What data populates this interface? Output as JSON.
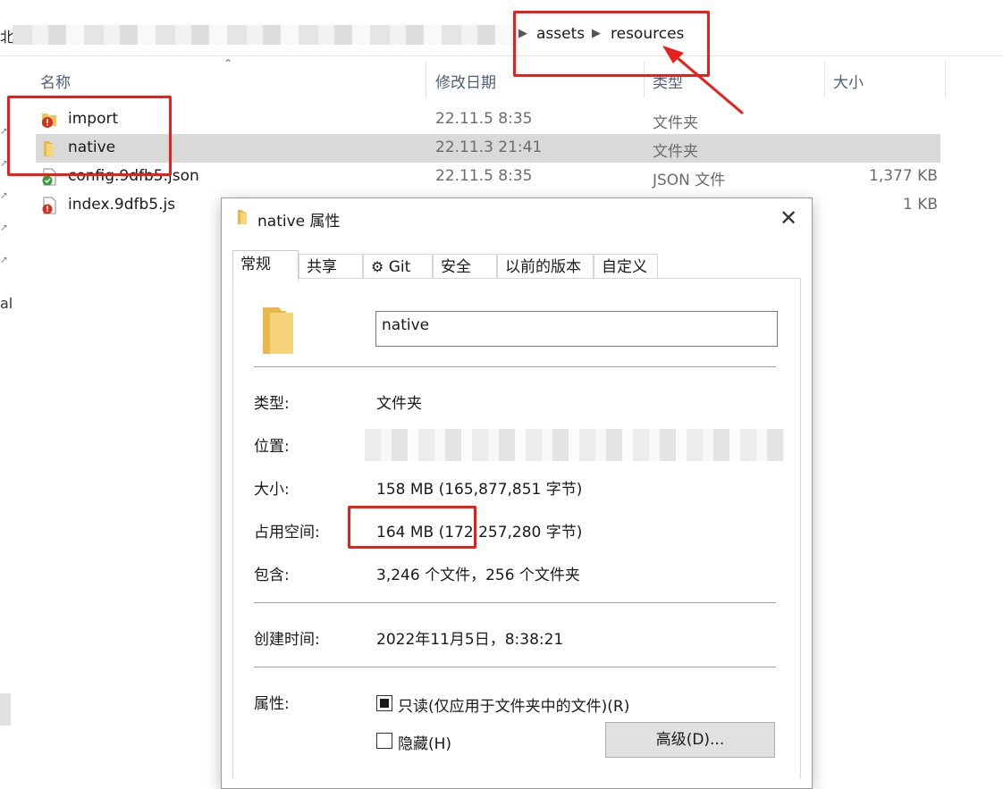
{
  "breadcrumb": {
    "left_fragment": "北",
    "items": [
      "assets",
      "resources"
    ]
  },
  "columns": {
    "name": "名称",
    "modified": "修改日期",
    "type": "类型",
    "size": "大小"
  },
  "files": [
    {
      "name": "import",
      "date": "22.11.5 8:35",
      "type": "文件夹",
      "size": "",
      "icon": "folder-error-icon"
    },
    {
      "name": "native",
      "date": "22.11.3 21:41",
      "type": "文件夹",
      "size": "",
      "icon": "folder-icon",
      "selected": true
    },
    {
      "name": "config.9dfb5.json",
      "date": "22.11.5 8:35",
      "type": "JSON 文件",
      "size": "1,377 KB",
      "icon": "json-file-ok-icon"
    },
    {
      "name": "index.9dfb5.js",
      "date": "",
      "type": "",
      "size": "1 KB",
      "icon": "js-file-error-icon"
    }
  ],
  "left_pane": {
    "text_fragment": "al"
  },
  "dialog": {
    "title": "native 属性",
    "tabs": [
      "常规",
      "共享",
      "Git",
      "安全",
      "以前的版本",
      "自定义"
    ],
    "active_tab": "常规",
    "folder_name": "native",
    "type_label": "类型:",
    "type_value": "文件夹",
    "location_label": "位置:",
    "size_label": "大小:",
    "size_value": "158 MB (165,877,851 字节)",
    "disk_label": "占用空间:",
    "disk_value": "164 MB (172,257,280 字节)",
    "contains_label": "包含:",
    "contains_value": "3,246 个文件，256 个文件夹",
    "created_label": "创建时间:",
    "created_value": "2022年11月5日，8:38:21",
    "attr_label": "属性:",
    "readonly_label": "只读(仅应用于文件夹中的文件)(R)",
    "hidden_label": "隐藏(H)",
    "advanced_button": "高级(D)..."
  },
  "colors": {
    "annotation_red": "#e8201d",
    "selection": "#d9d9d9",
    "header_text": "#4c607a"
  }
}
